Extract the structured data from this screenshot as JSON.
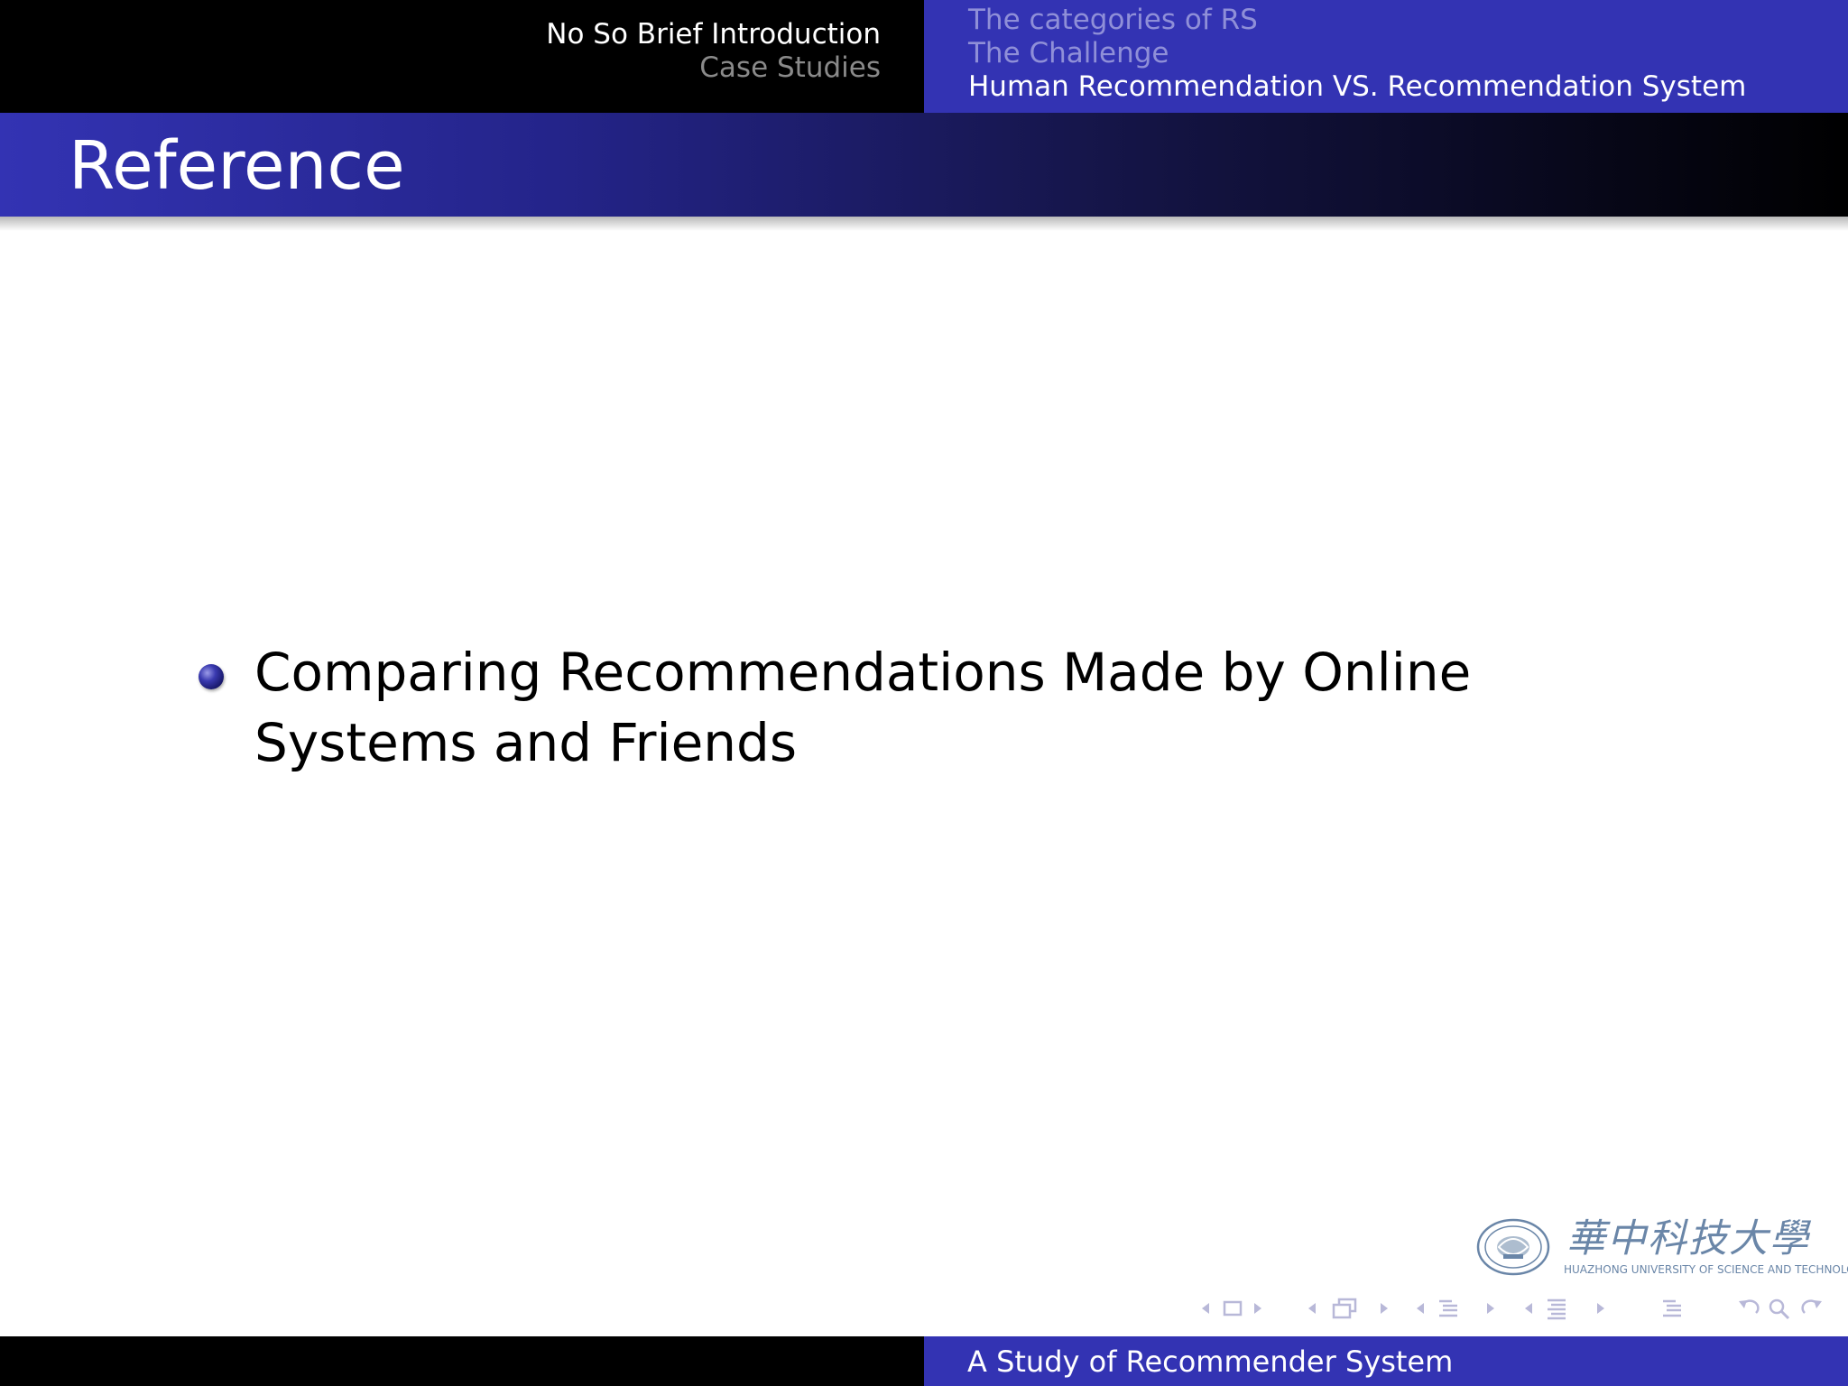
{
  "header": {
    "sections": [
      {
        "label": "No So Brief Introduction",
        "active": true
      },
      {
        "label": "Case Studies",
        "active": false
      }
    ],
    "subsections": [
      {
        "label": "The categories of RS",
        "active": false
      },
      {
        "label": "The Challenge",
        "active": false
      },
      {
        "label": "Human Recommendation VS. Recommendation System",
        "active": true
      }
    ]
  },
  "frame": {
    "title": "Reference",
    "bullets": [
      "Comparing Recommendations Made by Online Systems and Friends"
    ]
  },
  "logo": {
    "chinese_name": "華中科技大學",
    "english_name": "HUAZHONG UNIVERSITY OF SCIENCE AND TECHNOLOGY"
  },
  "navigation": {
    "icons": [
      "frame-back-icon",
      "frame-icon",
      "frame-forward-icon",
      "subsection-back-icon",
      "subsection-icon",
      "subsection-forward-icon",
      "section-back-icon",
      "section-icon",
      "section-forward-icon",
      "presentation-back-icon",
      "presentation-icon",
      "presentation-forward-icon",
      "appendix-icon",
      "go-back-icon",
      "search-icon",
      "go-forward-icon"
    ],
    "icon_color": "#b8b8d8"
  },
  "footer": {
    "title": "A Study of Recommender System"
  },
  "colors": {
    "structure_blue": "#3333b3",
    "black": "#000000",
    "white": "#ffffff"
  }
}
